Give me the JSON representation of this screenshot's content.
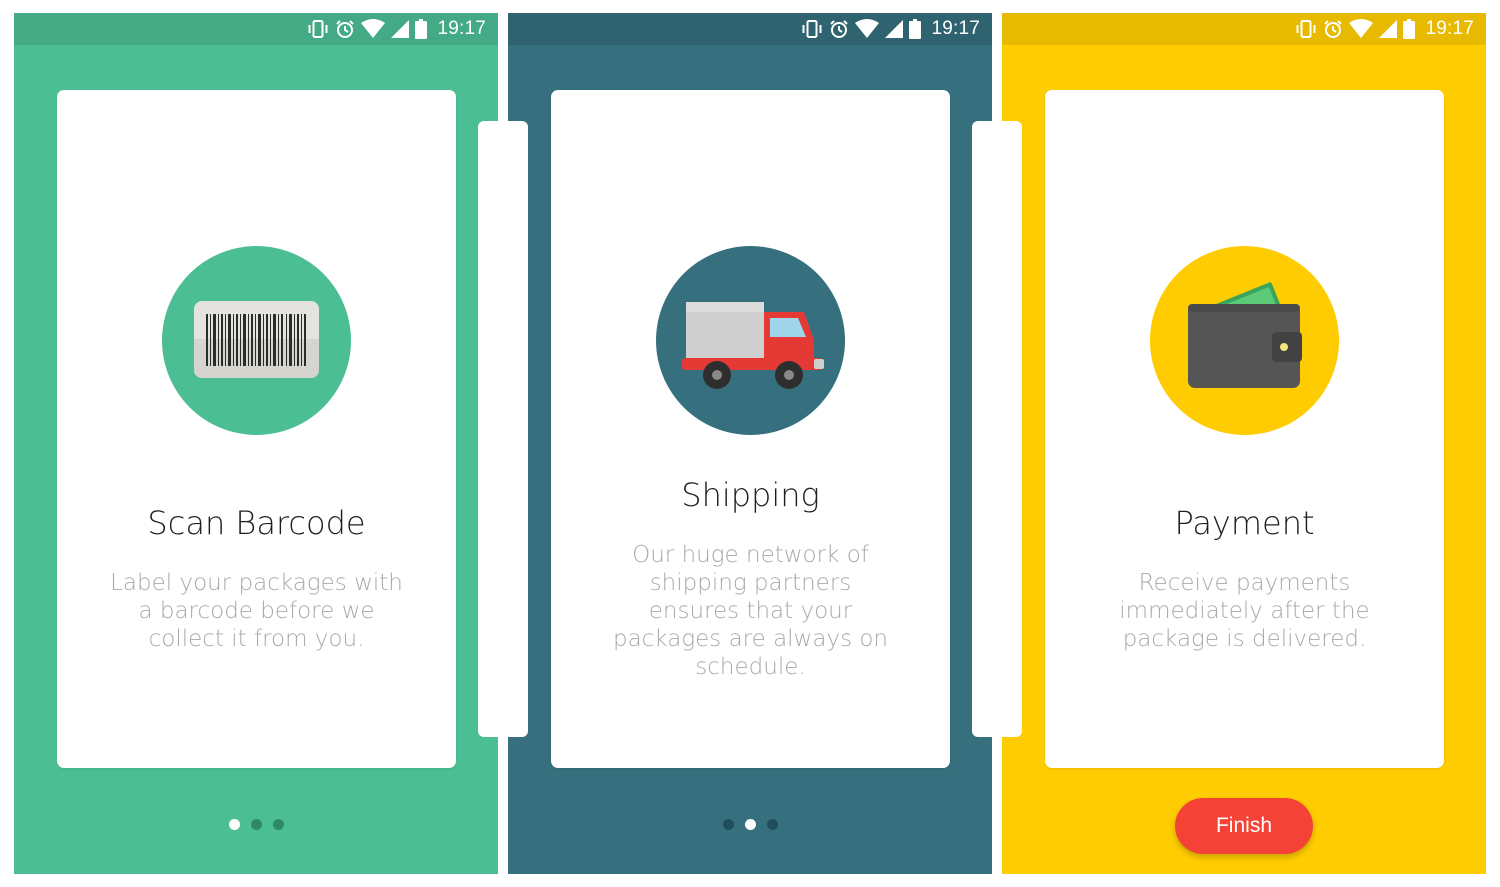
{
  "status_bar": {
    "time": "19:17",
    "icons": [
      "vibrate-icon",
      "alarm-icon",
      "wifi-icon",
      "cell-signal-icon",
      "battery-icon"
    ]
  },
  "screens": [
    {
      "title": "Scan Barcode",
      "description": "Label your packages with a barcode before we collect it from you.",
      "icon": "barcode-icon",
      "background_color": "#4bbe94",
      "page_indicator": {
        "total": 3,
        "active": 1
      }
    },
    {
      "title": "Shipping",
      "description": "Our huge network of shipping partners ensures that your packages are always on schedule.",
      "icon": "truck-icon",
      "background_color": "#36707f",
      "page_indicator": {
        "total": 3,
        "active": 2
      }
    },
    {
      "title": "Payment",
      "description": "Receive payments immediately after the package is delivered.",
      "icon": "wallet-icon",
      "background_color": "#fecc00",
      "finish_label": "Finish",
      "finish_color": "#f44336"
    }
  ]
}
